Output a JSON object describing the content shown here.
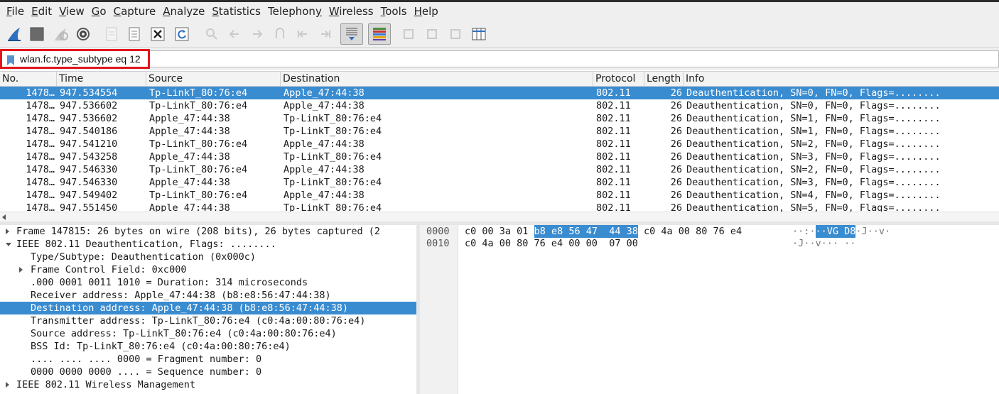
{
  "menu": [
    "File",
    "Edit",
    "View",
    "Go",
    "Capture",
    "Analyze",
    "Statistics",
    "Telephony",
    "Wireless",
    "Tools",
    "Help"
  ],
  "menu_mnemonic": [
    "F",
    "E",
    "V",
    "G",
    "C",
    "A",
    "S",
    "y",
    "W",
    "T",
    "H"
  ],
  "toolbar": {
    "icons": [
      "shark-fin-start-icon",
      "stop-capture-icon",
      "restart-capture-icon",
      "capture-options-gear-icon",
      "open-file-icon",
      "save-file-icon",
      "close-file-icon",
      "reload-file-icon",
      "find-packet-icon",
      "go-back-icon",
      "go-forward-icon",
      "go-to-packet-icon",
      "first-packet-icon",
      "last-packet-icon",
      "autoscroll-icon",
      "colorize-icon",
      "zoom-in-icon",
      "zoom-out-icon",
      "normal-size-icon",
      "resize-columns-icon"
    ]
  },
  "filter": {
    "value": "wlan.fc.type_subtype eq 12",
    "highlight_color": "#e5141b"
  },
  "packet_list": {
    "columns": [
      "No.",
      "Time",
      "Source",
      "Destination",
      "Protocol",
      "Length",
      "Info"
    ],
    "selected_index": 0,
    "rows": [
      {
        "no": "1478…",
        "time": "947.534554",
        "source": "Tp-LinkT_80:76:e4",
        "destination": "Apple_47:44:38",
        "protocol": "802.11",
        "length": "26",
        "info": "Deauthentication, SN=0, FN=0, Flags=........"
      },
      {
        "no": "1478…",
        "time": "947.536602",
        "source": "Tp-LinkT_80:76:e4",
        "destination": "Apple_47:44:38",
        "protocol": "802.11",
        "length": "26",
        "info": "Deauthentication, SN=0, FN=0, Flags=........"
      },
      {
        "no": "1478…",
        "time": "947.536602",
        "source": "Apple_47:44:38",
        "destination": "Tp-LinkT_80:76:e4",
        "protocol": "802.11",
        "length": "26",
        "info": "Deauthentication, SN=1, FN=0, Flags=........"
      },
      {
        "no": "1478…",
        "time": "947.540186",
        "source": "Apple_47:44:38",
        "destination": "Tp-LinkT_80:76:e4",
        "protocol": "802.11",
        "length": "26",
        "info": "Deauthentication, SN=1, FN=0, Flags=........"
      },
      {
        "no": "1478…",
        "time": "947.541210",
        "source": "Tp-LinkT_80:76:e4",
        "destination": "Apple_47:44:38",
        "protocol": "802.11",
        "length": "26",
        "info": "Deauthentication, SN=2, FN=0, Flags=........"
      },
      {
        "no": "1478…",
        "time": "947.543258",
        "source": "Apple_47:44:38",
        "destination": "Tp-LinkT_80:76:e4",
        "protocol": "802.11",
        "length": "26",
        "info": "Deauthentication, SN=3, FN=0, Flags=........"
      },
      {
        "no": "1478…",
        "time": "947.546330",
        "source": "Tp-LinkT_80:76:e4",
        "destination": "Apple_47:44:38",
        "protocol": "802.11",
        "length": "26",
        "info": "Deauthentication, SN=2, FN=0, Flags=........"
      },
      {
        "no": "1478…",
        "time": "947.546330",
        "source": "Apple_47:44:38",
        "destination": "Tp-LinkT_80:76:e4",
        "protocol": "802.11",
        "length": "26",
        "info": "Deauthentication, SN=3, FN=0, Flags=........"
      },
      {
        "no": "1478…",
        "time": "947.549402",
        "source": "Tp-LinkT_80:76:e4",
        "destination": "Apple_47:44:38",
        "protocol": "802.11",
        "length": "26",
        "info": "Deauthentication, SN=4, FN=0, Flags=........"
      },
      {
        "no": "1478…",
        "time": "947.551450",
        "source": "Apple_47:44:38",
        "destination": "Tp-LinkT_80:76:e4",
        "protocol": "802.11",
        "length": "26",
        "info": "Deauthentication, SN=5, FN=0, Flags=........"
      }
    ]
  },
  "details": {
    "rows": [
      {
        "text": "Frame 147815: 26 bytes on wire (208 bits), 26 bytes captured (2",
        "arrow": "collapsed",
        "level": 0,
        "selected": false
      },
      {
        "text": "IEEE 802.11 Deauthentication, Flags: ........",
        "arrow": "expanded",
        "level": 0,
        "selected": false
      },
      {
        "text": "Type/Subtype: Deauthentication (0x000c)",
        "arrow": "none",
        "level": 1,
        "selected": false
      },
      {
        "text": "Frame Control Field: 0xc000",
        "arrow": "collapsed",
        "level": 1,
        "selected": false
      },
      {
        "text": ".000 0001 0011 1010 = Duration: 314 microseconds",
        "arrow": "none",
        "level": 1,
        "selected": false
      },
      {
        "text": "Receiver address: Apple_47:44:38 (b8:e8:56:47:44:38)",
        "arrow": "none",
        "level": 1,
        "selected": false
      },
      {
        "text": "Destination address: Apple_47:44:38 (b8:e8:56:47:44:38)",
        "arrow": "none",
        "level": 1,
        "selected": true
      },
      {
        "text": "Transmitter address: Tp-LinkT_80:76:e4 (c0:4a:00:80:76:e4)",
        "arrow": "none",
        "level": 1,
        "selected": false
      },
      {
        "text": "Source address: Tp-LinkT_80:76:e4 (c0:4a:00:80:76:e4)",
        "arrow": "none",
        "level": 1,
        "selected": false
      },
      {
        "text": "BSS Id: Tp-LinkT_80:76:e4 (c0:4a:00:80:76:e4)",
        "arrow": "none",
        "level": 1,
        "selected": false
      },
      {
        "text": ".... .... .... 0000 = Fragment number: 0",
        "arrow": "none",
        "level": 1,
        "selected": false
      },
      {
        "text": "0000 0000 0000 .... = Sequence number: 0",
        "arrow": "none",
        "level": 1,
        "selected": false
      },
      {
        "text": "IEEE 802.11 Wireless Management",
        "arrow": "collapsed",
        "level": 0,
        "selected": false
      }
    ]
  },
  "bytes": {
    "rows": [
      {
        "offset": "0000",
        "hex_pre": "c0 00 3a 01 ",
        "hex_hl": "b8 e8 56 47  44 38",
        "hex_post": " c0 4a 00 80 76 e4",
        "ascii_pre": "··:·",
        "ascii_hl": "··VG D8",
        "ascii_post": "·J··v·"
      },
      {
        "offset": "0010",
        "hex_pre": "c0 4a 00 80 76 e4 00 00  07 00",
        "hex_hl": "",
        "hex_post": "",
        "ascii_pre": "·J··v··· ··",
        "ascii_hl": "",
        "ascii_post": ""
      }
    ]
  }
}
